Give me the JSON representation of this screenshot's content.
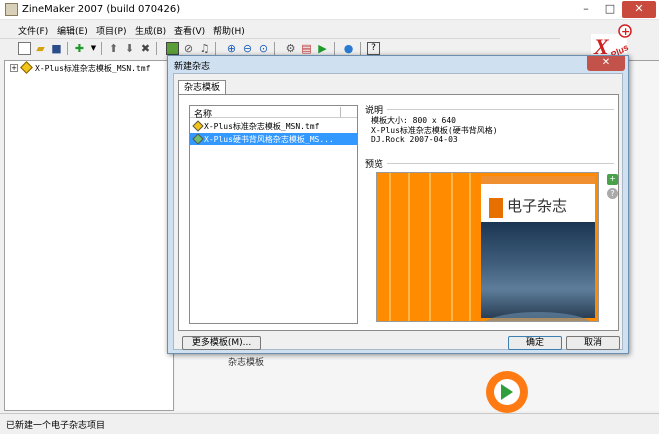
{
  "window": {
    "title": "ZineMaker 2007 (build 070426)",
    "minimize": "–",
    "maximize": "□",
    "close": "✕"
  },
  "menu": [
    {
      "label": "文件(F)"
    },
    {
      "label": "编辑(E)"
    },
    {
      "label": "项目(P)"
    },
    {
      "label": "生成(B)"
    },
    {
      "label": "查看(V)"
    },
    {
      "label": "帮助(H)"
    }
  ],
  "tree": {
    "expand": "+",
    "item": "X-Plus标准杂志模板_MSN.tmf"
  },
  "dialog": {
    "title": "新建杂志",
    "close": "✕",
    "tab_label": "杂志模板",
    "list_header": "名称",
    "templates": [
      {
        "label": "X-Plus标准杂志模板_MSN.tmf",
        "icon_color": "#f3c417"
      },
      {
        "label": "X-Plus硬书背风格杂志模板_MS...",
        "icon_color": "#6fbf6f"
      }
    ],
    "description_caption": "说明",
    "description_lines": [
      "模板大小: 800 x 640",
      "X-Plus标准杂志模板(硬书背风格)",
      "DJ.Rock 2007-04-03"
    ],
    "preview_caption": "预览",
    "preview": {
      "title": "电子杂志"
    },
    "buttons": {
      "more": "更多模板(M)...",
      "ok": "确定",
      "cancel": "取消"
    }
  },
  "background": {
    "tab_label": "杂志模板"
  },
  "status": "已新建一个电子杂志项目",
  "colors": {
    "accent_selected": "#3399ff",
    "template_orange": "#ff8a00"
  }
}
